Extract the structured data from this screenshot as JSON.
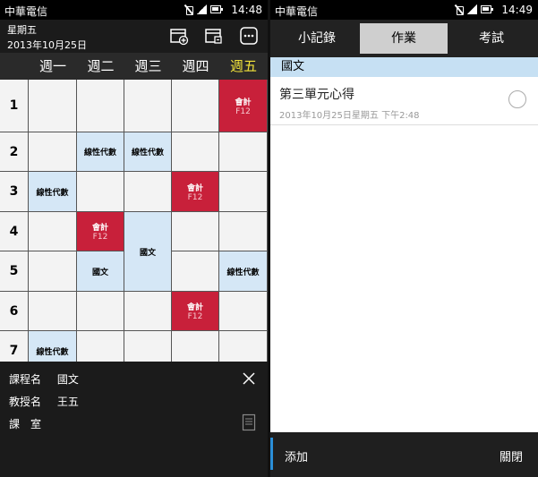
{
  "left": {
    "status": {
      "carrier": "中華電信",
      "time": "14:48"
    },
    "header": {
      "weekday": "星期五",
      "date": "2013年10月25日"
    },
    "days": [
      "週一",
      "週二",
      "週三",
      "週四",
      "週五"
    ],
    "rows": [
      "1",
      "2",
      "3",
      "4",
      "5",
      "6",
      "7"
    ],
    "events": [
      {
        "name": "會計",
        "room": "F12",
        "style": "red",
        "day": 5,
        "row": 1,
        "span": 1
      },
      {
        "name": "線性代數",
        "room": "",
        "style": "blue",
        "day": 2,
        "row": 2,
        "span": 1
      },
      {
        "name": "線性代數",
        "room": "",
        "style": "blue",
        "day": 3,
        "row": 2,
        "span": 1
      },
      {
        "name": "線性代數",
        "room": "",
        "style": "blue",
        "day": 1,
        "row": 3,
        "span": 1
      },
      {
        "name": "會計",
        "room": "F12",
        "style": "red",
        "day": 4,
        "row": 3,
        "span": 1
      },
      {
        "name": "會計",
        "room": "F12",
        "style": "red",
        "day": 2,
        "row": 4,
        "span": 1
      },
      {
        "name": "國文",
        "room": "",
        "style": "blue",
        "day": 3,
        "row": 4,
        "span": 2
      },
      {
        "name": "國文",
        "room": "",
        "style": "blue",
        "day": 2,
        "row": 5,
        "span": 1
      },
      {
        "name": "線性代數",
        "room": "",
        "style": "blue",
        "day": 5,
        "row": 5,
        "span": 1
      },
      {
        "name": "會計",
        "room": "F12",
        "style": "red",
        "day": 4,
        "row": 6,
        "span": 1
      },
      {
        "name": "線性代數",
        "room": "",
        "style": "blue",
        "day": 1,
        "row": 7,
        "span": 1
      }
    ],
    "detail": {
      "course_label": "課程名",
      "course_value": "國文",
      "teacher_label": "教授名",
      "teacher_value": "王五",
      "room_label": "課　室",
      "room_value": ""
    }
  },
  "right": {
    "status": {
      "carrier": "中華電信",
      "time": "14:49"
    },
    "tabs": [
      {
        "label": "小記錄",
        "active": false
      },
      {
        "label": "作業",
        "active": true
      },
      {
        "label": "考試",
        "active": false
      }
    ],
    "section": "國文",
    "item": {
      "title": "第三單元心得",
      "time": "2013年10月25日星期五 下午2:48"
    },
    "footer": {
      "add_label": "添加",
      "close_label": "關閉"
    }
  },
  "colors": {
    "today_header": "#f2e33a",
    "event_red": "#c8203a",
    "event_blue": "#d5e7f6",
    "section_bg": "#c6e0f3",
    "footer_accent": "#2b8fd8"
  }
}
